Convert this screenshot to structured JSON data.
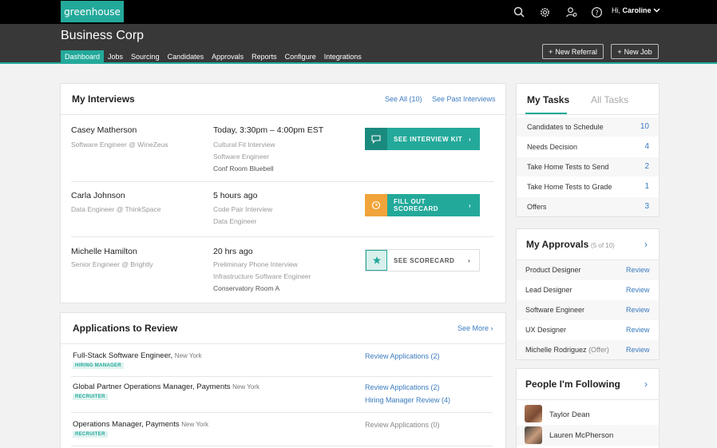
{
  "topbar": {
    "logo": "greenhouse",
    "icons": [
      "search-icon",
      "gear-icon",
      "people-icon",
      "help-icon"
    ],
    "greeting_prefix": "Hi,",
    "user_name": "Caroline"
  },
  "header": {
    "company": "Business Corp",
    "nav": [
      "Dashboard",
      "Jobs",
      "Sourcing",
      "Candidates",
      "Approvals",
      "Reports",
      "Configure",
      "Integrations"
    ],
    "active_nav": "Dashboard",
    "new_referral": "New Referral",
    "new_job": "New Job"
  },
  "interviews": {
    "title": "My Interviews",
    "see_all": "See All (10)",
    "see_past": "See Past Interviews",
    "items": [
      {
        "name": "Casey Matherson",
        "role": "Software Engineer @ WineZeus",
        "time": "Today, 3:30pm – 4:00pm EST",
        "line1": "Cultural Fit Interview",
        "line2": "Software Engineer",
        "line3": "Conf Room Bluebell",
        "action": "SEE INTERVIEW KIT"
      },
      {
        "name": "Carla Johnson",
        "role": "Data Engineer @ ThinkSpace",
        "time": "5 hours ago",
        "line1": "Code Pair Interview",
        "line2": "Data Engineer",
        "action": "FILL OUT SCORECARD"
      },
      {
        "name": "Michelle Hamilton",
        "role": "Senior Engineer @ Brightly",
        "time": "20 hrs ago",
        "line1": "Preliminary Phone Interview",
        "line2": "Infrastructure Software Engineer",
        "line3": "Conservatory Room A",
        "action": "SEE SCORECARD"
      }
    ]
  },
  "applications": {
    "title": "Applications to Review",
    "see_more": "See More",
    "items": [
      {
        "title": "Full-Stack Software Engineer,",
        "location": "New York",
        "badge": "HIRING MANAGER",
        "link1": "Review Applications (2)"
      },
      {
        "title": "Global Partner Operations Manager, Payments",
        "location": "New York",
        "badge": "RECRUITER",
        "link1": "Review Applications (2)",
        "link2": "Hiring Manager Review (4)"
      },
      {
        "title": "Operations Manager, Payments",
        "location": "New York",
        "badge": "RECRUITER",
        "link1": "Review Applications (0)"
      }
    ]
  },
  "tasks": {
    "tab_mine": "My Tasks",
    "tab_all": "All Tasks",
    "items": [
      {
        "label": "Candidates to Schedule",
        "count": "10"
      },
      {
        "label": "Needs Decision",
        "count": "4"
      },
      {
        "label": "Take Home Tests to Send",
        "count": "2"
      },
      {
        "label": "Take Home Tests to Grade",
        "count": "1"
      },
      {
        "label": "Offers",
        "count": "3"
      }
    ]
  },
  "approvals": {
    "title": "My Approvals",
    "count": "(5 of 10)",
    "review_label": "Review",
    "items": [
      {
        "label": "Product Designer",
        "suffix": ""
      },
      {
        "label": "Lead Designer",
        "suffix": ""
      },
      {
        "label": "Software Engineer",
        "suffix": ""
      },
      {
        "label": "UX Designer",
        "suffix": ""
      },
      {
        "label": "Michelle Rodriguez",
        "suffix": "(Offer)"
      }
    ]
  },
  "following": {
    "title": "People I'm Following",
    "people": [
      "Taylor Dean",
      "Lauren McPherson"
    ]
  },
  "colors": {
    "accent": "#23a99a",
    "orange": "#f0a43a",
    "link": "#3b7bbf",
    "topbar": "#000000",
    "header": "#383838"
  }
}
